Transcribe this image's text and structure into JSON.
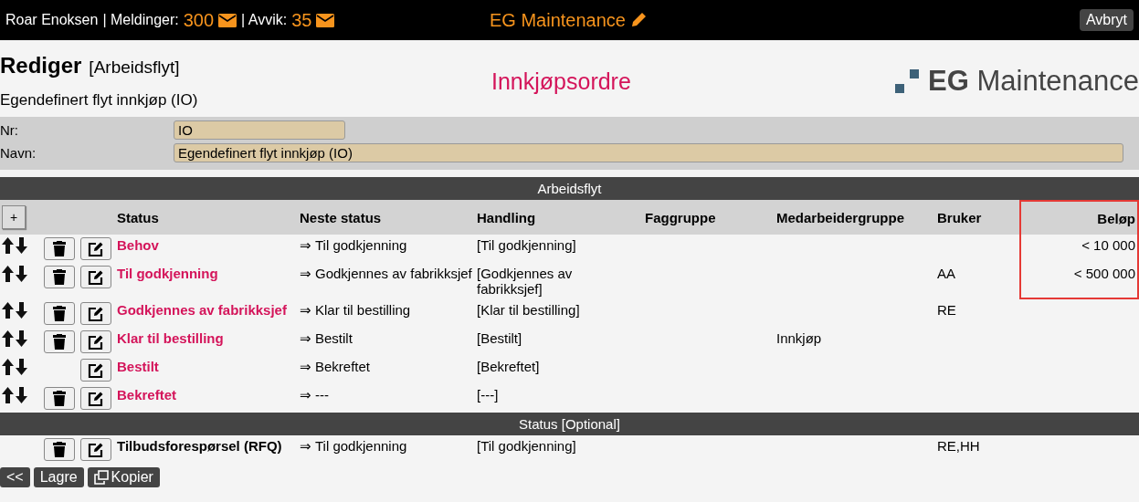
{
  "top_bar": {
    "user": "Roar Enoksen",
    "counters": [
      {
        "label": "| Meldinger:",
        "count": "300"
      },
      {
        "label": "| Avvik:",
        "count": "35"
      }
    ],
    "app_title": "EG Maintenance",
    "cancel_button": "Avbryt"
  },
  "header": {
    "title": "Rediger",
    "subtitle": "[Arbeidsflyt]",
    "description": "Egendefinert flyt innkjøp (IO)",
    "center_title": "Innkjøpsordre",
    "logo": "**EG** Maintenance"
  },
  "form": [
    {
      "label": "Nr:",
      "value": "IO",
      "wide": false
    },
    {
      "label": "Navn:",
      "value": "Egendefinert flyt innkjøp (IO)",
      "wide": true
    }
  ],
  "workflow": {
    "section_title": "Arbeidsflyt",
    "add_button": "+",
    "columns": [
      {
        "label": "Status",
        "highlighted": false
      },
      {
        "label": "Neste status",
        "highlighted": false
      },
      {
        "label": "Handling",
        "highlighted": false
      },
      {
        "label": "Faggruppe",
        "highlighted": false
      },
      {
        "label": "Medarbeidergruppe",
        "highlighted": false
      },
      {
        "label": "Bruker",
        "highlighted": false
      },
      {
        "label": "Beløp",
        "highlighted": true
      }
    ],
    "rows": [
      {
        "kind": "workflow",
        "deletable": true,
        "status": "Behov",
        "next": "⇒",
        "next_status": "Til godkjenning",
        "action": "[Til godkjenning]",
        "amount": "< 10 000",
        "highlighted": true
      },
      {
        "kind": "workflow",
        "deletable": true,
        "status": "Til godkjenning",
        "next": "⇒",
        "next_status": "Godkjennes av fabrikksjef",
        "action": "[Godkjennes av fabrikksjef]",
        "user": "AA",
        "amount": "< 500 000",
        "highlighted": true
      },
      {
        "kind": "workflow",
        "deletable": true,
        "status": "Godkjennes av fabrikksjef",
        "next": "⇒",
        "next_status": "Klar til bestilling",
        "action": "[Klar til bestilling]",
        "user": "RE",
        "highlighted": false
      },
      {
        "kind": "workflow",
        "deletable": true,
        "status": "Klar til bestilling",
        "next": "⇒",
        "next_status": "Bestilt",
        "action": "[Bestilt]",
        "group": "Innkjøp",
        "highlighted": false
      },
      {
        "kind": "workflow",
        "deletable": false,
        "status": "Bestilt",
        "next": "⇒",
        "next_status": "Bekreftet",
        "action": "[Bekreftet]",
        "highlighted": false
      },
      {
        "kind": "workflow",
        "deletable": true,
        "status": "Bekreftet",
        "next": "⇒",
        "next_status": "---",
        "action": "[---]",
        "highlighted": false
      }
    ],
    "optional_title": "Status [Optional]",
    "optional_rows": [
      {
        "kind": "optional",
        "deletable": true,
        "status": "Tilbudsforespørsel (RFQ)",
        "next": "⇒",
        "next_status": "Til godkjenning",
        "action": "[Til godkjenning]",
        "user": "RE,HH",
        "highlighted": false
      }
    ]
  },
  "buttons": [
    {
      "kind": "back",
      "label": "<<"
    },
    {
      "kind": "save",
      "label": "Lagre"
    },
    {
      "kind": "copy",
      "label": "Kopier"
    }
  ]
}
